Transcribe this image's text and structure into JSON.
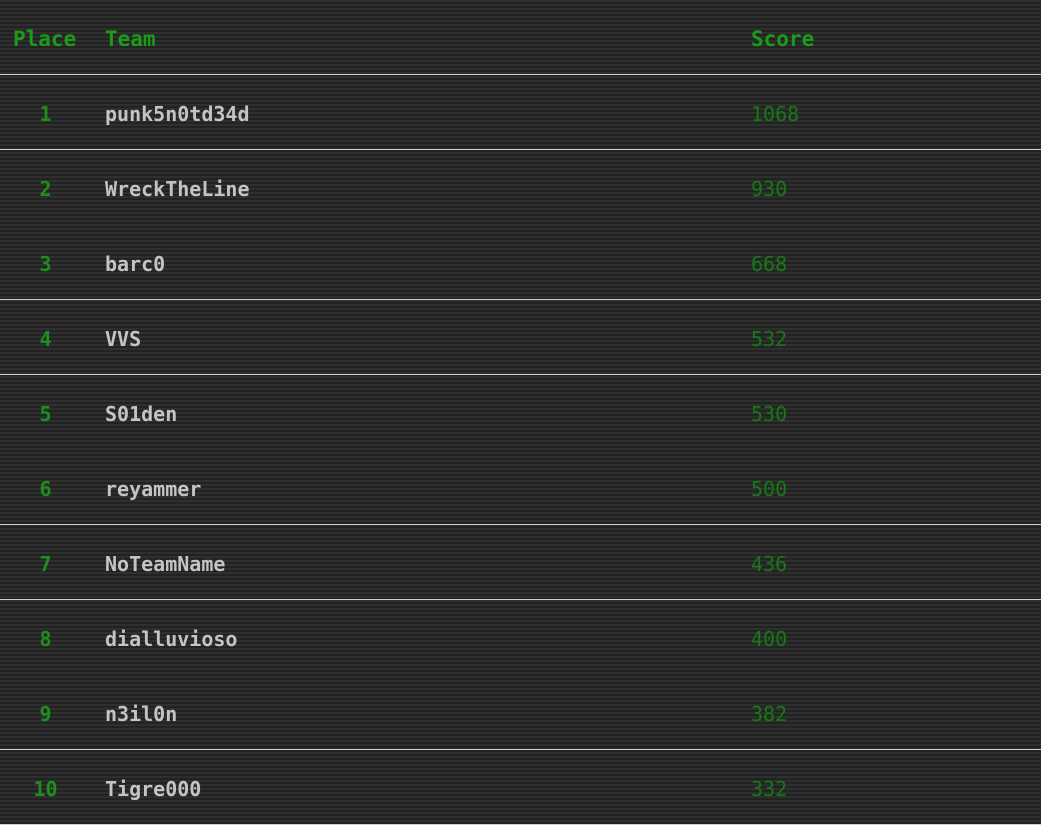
{
  "header": {
    "place_label": "Place",
    "team_label": "Team",
    "score_label": "Score"
  },
  "rows": [
    {
      "place": "1",
      "team": "punk5n0td34d",
      "score": "1068"
    },
    {
      "place": "2",
      "team": "WreckTheLine",
      "score": "930"
    },
    {
      "place": "3",
      "team": "barc0",
      "score": "668"
    },
    {
      "place": "4",
      "team": "VVS",
      "score": "532"
    },
    {
      "place": "5",
      "team": "S01den",
      "score": "530"
    },
    {
      "place": "6",
      "team": "reyammer",
      "score": "500"
    },
    {
      "place": "7",
      "team": "NoTeamName",
      "score": "436"
    },
    {
      "place": "8",
      "team": "dialluvioso",
      "score": "400"
    },
    {
      "place": "9",
      "team": "n3il0n",
      "score": "382"
    },
    {
      "place": "10",
      "team": "Tigre000",
      "score": "332"
    }
  ],
  "colors": {
    "header_text": "#1a9c1a",
    "place_text": "#1c8f1c",
    "team_text": "#c4c4c4",
    "score_text": "#157a15",
    "divider": "#d0d0d0",
    "background": "#2b2b2b"
  }
}
